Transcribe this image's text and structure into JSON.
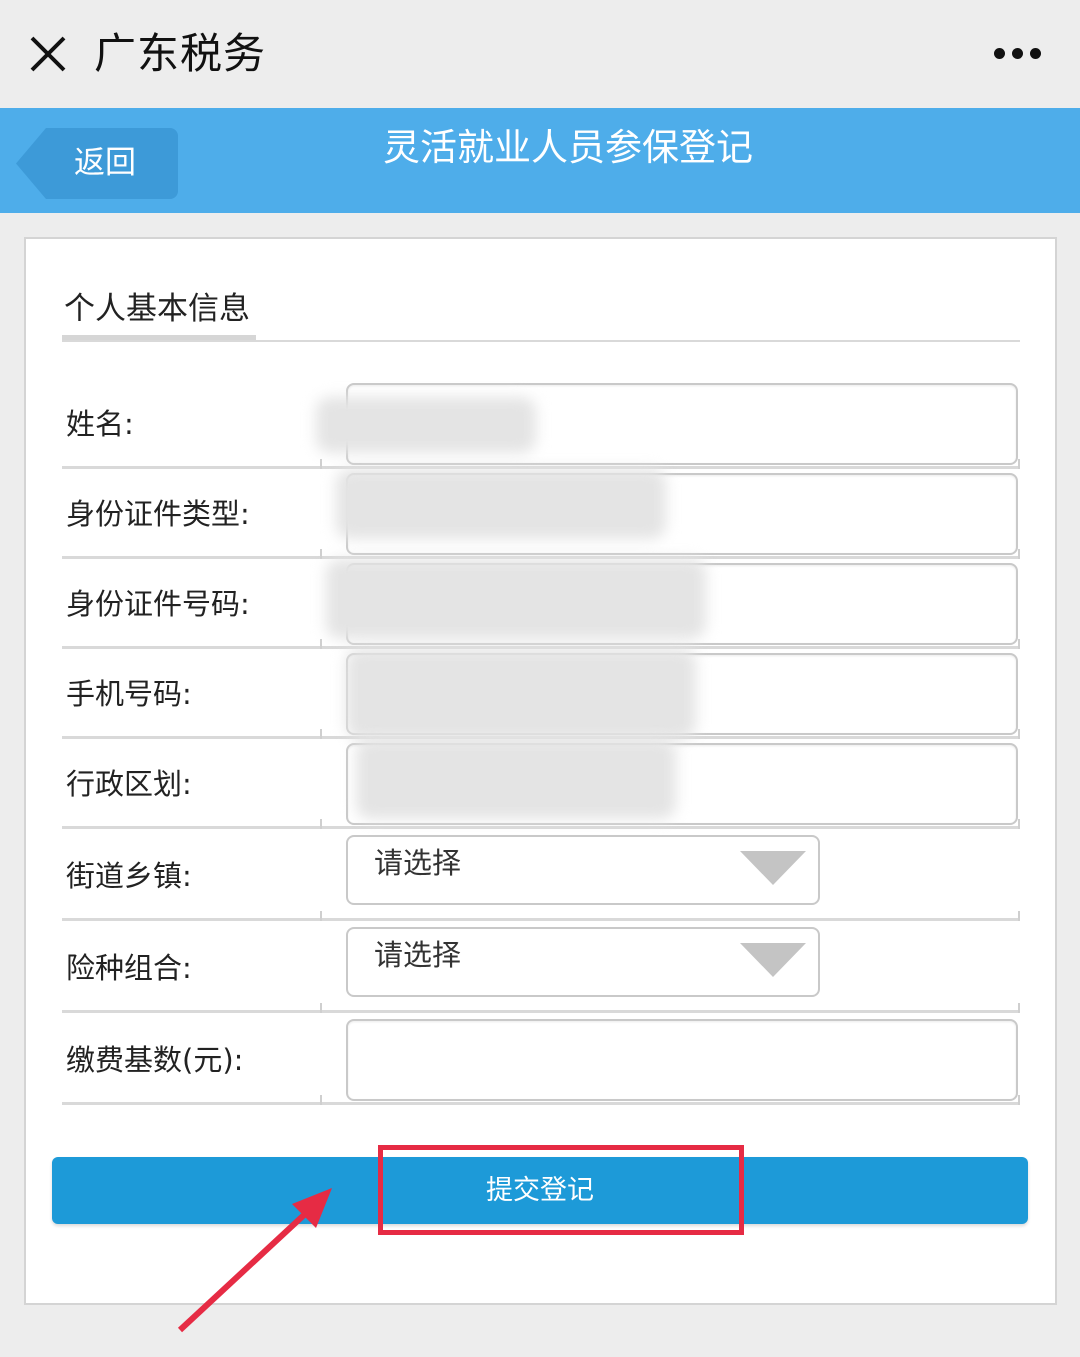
{
  "topbar": {
    "title": "广东税务",
    "close_icon": "close-icon",
    "more_icon": "more-icon"
  },
  "header": {
    "back_label": "返回",
    "title": "灵活就业人员参保登记",
    "color": "#4eadea"
  },
  "form": {
    "section_title": "个人基本信息",
    "fields": [
      {
        "label": "姓名:",
        "value": ""
      },
      {
        "label": "身份证件类型:",
        "value": ""
      },
      {
        "label": "身份证件号码:",
        "value": ""
      },
      {
        "label": "手机号码:",
        "value": ""
      },
      {
        "label": "行政区划:",
        "value": ""
      }
    ],
    "selects": [
      {
        "label": "街道乡镇:",
        "value": "请选择"
      },
      {
        "label": "险种组合:",
        "value": "请选择"
      }
    ],
    "contribution": {
      "label": "缴费基数(元):",
      "value": ""
    },
    "submit_label": "提交登记",
    "submit_color": "#1d9ad8"
  },
  "annotation": {
    "highlight_color": "#e62b44"
  }
}
